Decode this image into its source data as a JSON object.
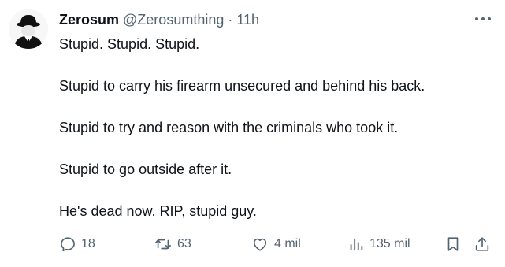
{
  "tweet": {
    "display_name": "Zerosum",
    "handle": "@Zerosumthing",
    "separator": "·",
    "time": "11h",
    "lines": [
      "Stupid. Stupid. Stupid.",
      "Stupid to carry his firearm unsecured and behind his back.",
      "Stupid to try and reason with the criminals who took it.",
      "Stupid to go outside after it.",
      "He's dead now. RIP, stupid guy."
    ]
  },
  "actions": {
    "replies": "18",
    "reposts": "63",
    "likes": "4 mil",
    "views": "135 mil"
  },
  "icons": {
    "avatar": "bowler-hat-figure-avatar",
    "more": "more-dots-icon",
    "reply": "reply-icon",
    "repost": "repost-icon",
    "like": "heart-icon",
    "views": "views-icon",
    "bookmark": "bookmark-icon",
    "share": "share-icon"
  },
  "colors": {
    "text": "#0f1419",
    "secondary": "#536471",
    "background": "#ffffff"
  }
}
